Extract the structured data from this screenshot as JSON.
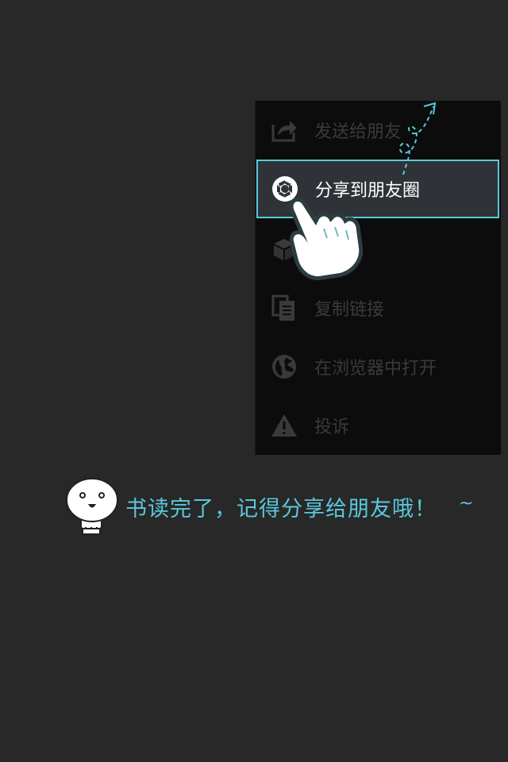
{
  "menu": {
    "items": [
      {
        "label": "发送给朋友",
        "icon": "share-arrow-icon",
        "state": "dimmed"
      },
      {
        "label": "分享到朋友圈",
        "icon": "aperture-icon",
        "state": "highlighted"
      },
      {
        "label": "",
        "icon": "box-icon",
        "state": "dimmed"
      },
      {
        "label": "复制链接",
        "icon": "copy-icon",
        "state": "dimmed"
      },
      {
        "label": "在浏览器中打开",
        "icon": "globe-icon",
        "state": "dimmed"
      },
      {
        "label": "投诉",
        "icon": "warning-icon",
        "state": "dimmed"
      }
    ]
  },
  "tip": {
    "text": "书读完了，记得分享给朋友哦！",
    "tilde": "~"
  },
  "colors": {
    "background": "#282828",
    "menu_bg": "#0c0c0c",
    "accent": "#5ac8dc",
    "highlight_bg": "#2f3338",
    "dim_text": "#3a3a3a"
  }
}
